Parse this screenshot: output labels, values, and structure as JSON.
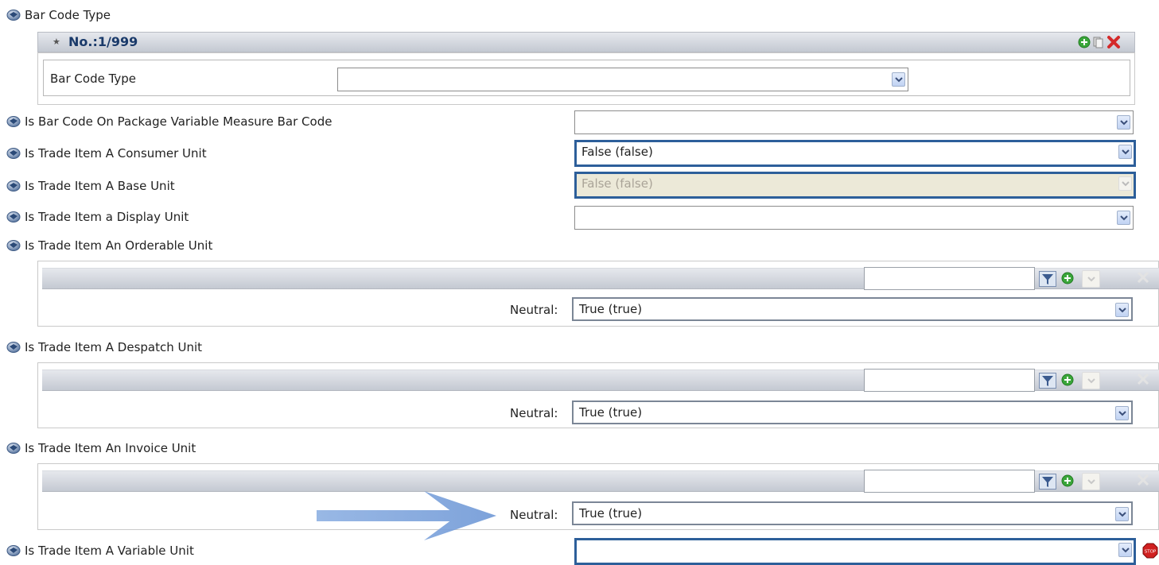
{
  "sections": {
    "bar_code_type": {
      "label": "Bar Code Type",
      "header": "No.:1/999",
      "field_label": "Bar Code Type",
      "field_value": ""
    },
    "rows": [
      {
        "label": "Is Bar Code On Package Variable Measure Bar Code",
        "value": ""
      },
      {
        "label": "Is Trade Item A Consumer Unit",
        "value": "False (false)"
      },
      {
        "label": "Is Trade Item A Base Unit",
        "value": "False (false)"
      },
      {
        "label": "Is Trade Item a Display Unit",
        "value": ""
      }
    ],
    "orderable": {
      "label": "Is Trade Item An Orderable Unit",
      "neutral_label": "Neutral:",
      "value": "True (true)",
      "filter_value": ""
    },
    "despatch": {
      "label": "Is Trade Item A Despatch Unit",
      "neutral_label": "Neutral:",
      "value": "True (true)",
      "filter_value": ""
    },
    "invoice": {
      "label": "Is Trade Item An Invoice Unit",
      "neutral_label": "Neutral:",
      "value": "True (true)",
      "filter_value": ""
    },
    "variable": {
      "label": "Is Trade Item A Variable Unit",
      "value": ""
    }
  },
  "colors": {
    "focus_border": "#2d5f9a",
    "arrow": "#8eb0e0",
    "header_text": "#1a3a6a",
    "add_green": "#3aa63a",
    "delete_red": "#d42a2a",
    "stop_red": "#d02020"
  },
  "icons": [
    "bullet-icon",
    "collapse-icon",
    "add-icon",
    "copy-icon",
    "delete-icon",
    "filter-icon",
    "dropdown-arrow-icon",
    "stop-icon",
    "annotation-arrow"
  ]
}
